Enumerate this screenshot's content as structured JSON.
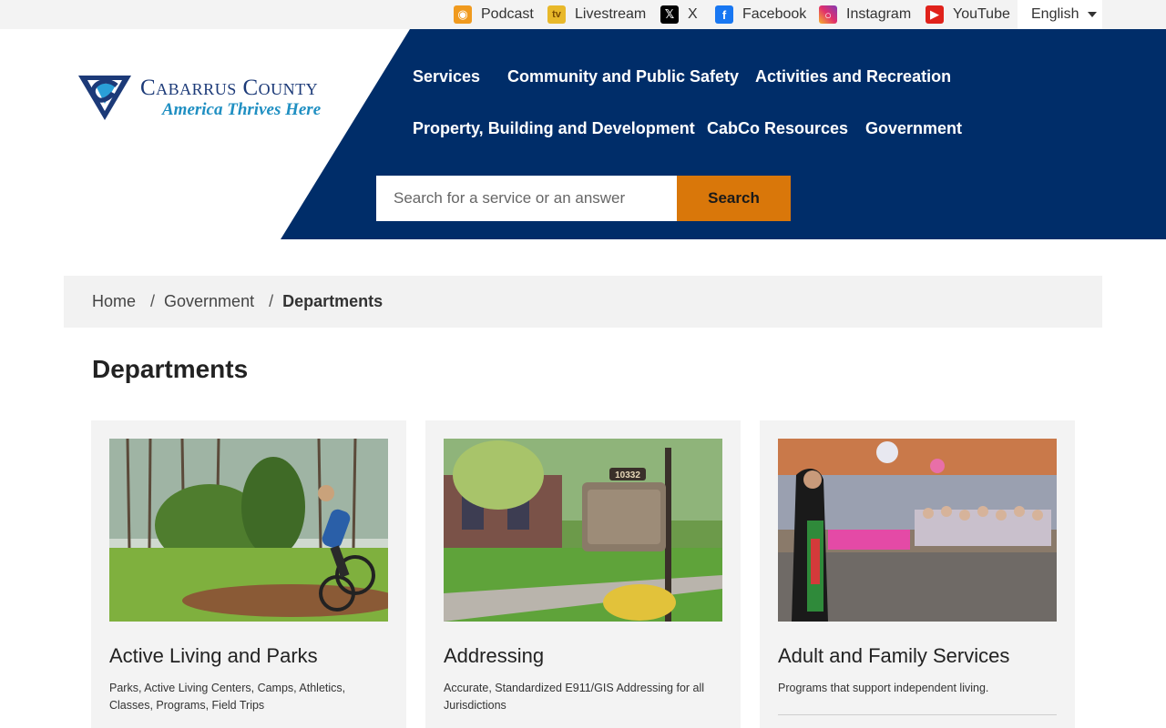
{
  "topbar": {
    "links": [
      {
        "label": "Podcast",
        "icon": "podcast-icon"
      },
      {
        "label": "Livestream",
        "icon": "livestream-icon"
      },
      {
        "label": "X",
        "icon": "x-icon"
      },
      {
        "label": "Facebook",
        "icon": "facebook-icon"
      },
      {
        "label": "Instagram",
        "icon": "instagram-icon"
      },
      {
        "label": "YouTube",
        "icon": "youtube-icon"
      }
    ],
    "language": "English"
  },
  "logo": {
    "name": "Cabarrus County",
    "tagline": "America Thrives Here"
  },
  "nav": {
    "row1": [
      "Services",
      "Community and Public Safety",
      "Activities and Recreation"
    ],
    "row2": [
      "Property, Building and Development",
      "CabCo Resources",
      "Government"
    ]
  },
  "search": {
    "placeholder": "Search for a service or an answer",
    "button": "Search"
  },
  "breadcrumb": {
    "home": "Home",
    "parent": "Government",
    "current": "Departments",
    "separator": "/"
  },
  "page_title": "Departments",
  "cards": [
    {
      "title": "Active Living and Parks",
      "description": "Parks, Active Living Centers, Camps, Athletics, Classes, Programs, Field Trips"
    },
    {
      "title": "Addressing",
      "description": "Accurate, Standardized E911/GIS Addressing for all Jurisdictions",
      "photo_text": "10332"
    },
    {
      "title": "Adult and Family Services",
      "description": "Programs that support independent living."
    }
  ],
  "colors": {
    "navy": "#002d69",
    "search_button": "#d9770a",
    "breadcrumb_bg": "#f2f2f2",
    "card_bg": "#f3f3f3",
    "topbar_bg": "#f3f3f3"
  }
}
